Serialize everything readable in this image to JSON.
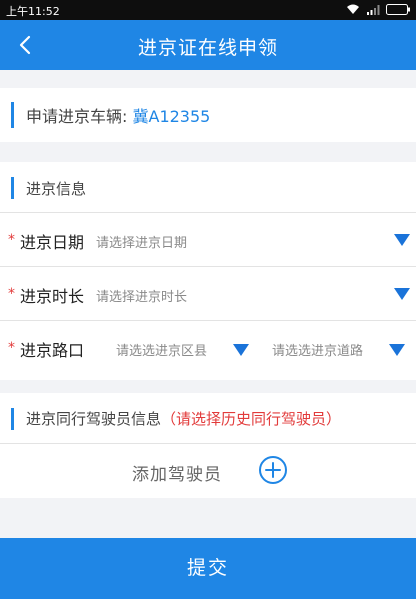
{
  "status_bar": {
    "time": "上午11:52",
    "icons": [
      "wifi-icon",
      "signal-icon",
      "battery-icon"
    ]
  },
  "nav": {
    "title": "进京证在线申领",
    "back_icon": "chevron-left-icon"
  },
  "vehicle": {
    "label": "申请进京车辆:",
    "plate": "冀A12355"
  },
  "info": {
    "section_title": "进京信息",
    "required_mark": "*",
    "date": {
      "label": "进京日期",
      "placeholder": "请选择进京日期"
    },
    "duration": {
      "label": "进京时长",
      "placeholder": "请选择进京时长"
    },
    "entry": {
      "label": "进京路口",
      "district_placeholder": "请选选进京区县",
      "road_placeholder": "请选选进京道路"
    }
  },
  "driver": {
    "section_title": "进京同行驾驶员信息",
    "hint": "（请选择历史同行驾驶员）",
    "add_label": "添加驾驶员"
  },
  "submit_label": "提交",
  "colors": {
    "primary": "#1f86e5",
    "dropdown_arrow": "#1a73d9",
    "required": "#e23b3b",
    "background": "#f2f3f6"
  }
}
